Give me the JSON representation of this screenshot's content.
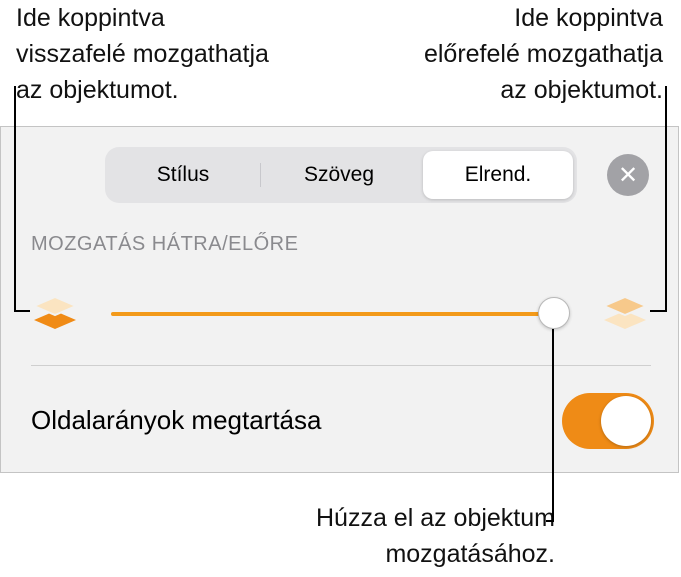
{
  "callouts": {
    "left": "Ide koppintva\nvisszafelé mozgathatja\naz objektumot.",
    "right": "Ide koppintva\nelőrefelé mozgathatja\naz objektumot.",
    "bottom": "Húzza el az objektum\nmozgatásához."
  },
  "tabs": [
    {
      "label": "Stílus",
      "selected": false
    },
    {
      "label": "Szöveg",
      "selected": false
    },
    {
      "label": "Elrend.",
      "selected": true
    }
  ],
  "close_icon": "close-icon",
  "section": {
    "label": "MOZGATÁS HÁTRA/ELŐRE"
  },
  "slider": {
    "value": 1.0,
    "icon_left": "send-backward-icon",
    "icon_right": "bring-forward-icon"
  },
  "option": {
    "label": "Oldalarányok megtartása",
    "toggle_on": true
  },
  "colors": {
    "accent": "#F0901A",
    "panel": "#F2F2F2",
    "label_gray": "#8A8A8E"
  }
}
